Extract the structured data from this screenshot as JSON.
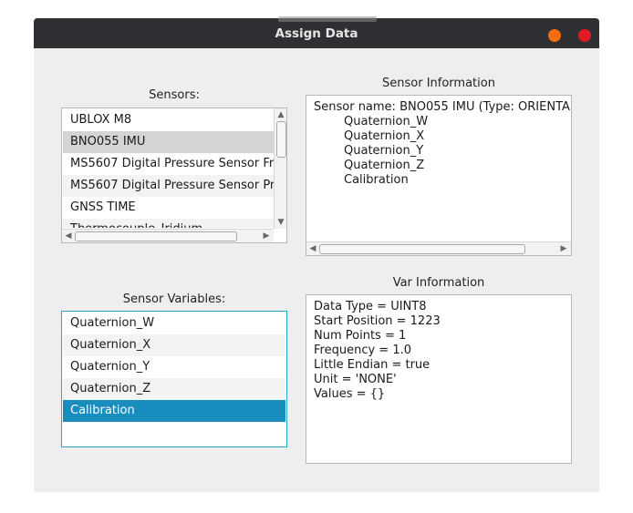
{
  "window": {
    "title": "Assign Data"
  },
  "sensors": {
    "label": "Sensors:",
    "items": [
      "UBLOX M8",
      "BNO055 IMU",
      "MS5607 Digital Pressure Sensor Fr",
      "MS5607 Digital Pressure Sensor Pr",
      "GNSS TIME",
      "Thermocouple_Iridium"
    ],
    "selected": "BNO055 IMU"
  },
  "sensor_info": {
    "label": "Sensor Information",
    "lines": [
      "Sensor name: BNO055 IMU (Type: ORIENTA",
      "Quaternion_W",
      "Quaternion_X",
      "Quaternion_Y",
      "Quaternion_Z",
      "Calibration"
    ]
  },
  "variables": {
    "label": "Sensor Variables:",
    "items": [
      "Quaternion_W",
      "Quaternion_X",
      "Quaternion_Y",
      "Quaternion_Z",
      "Calibration"
    ],
    "selected": "Calibration"
  },
  "var_info": {
    "label": "Var Information",
    "lines": [
      "Data Type = UINT8",
      "Start Position = 1223",
      "Num Points = 1",
      "Frequency = 1.0",
      "Little Endian = true",
      "Unit = 'NONE'",
      "Values = {}"
    ]
  },
  "colors": {
    "selection": "#1a8dbf",
    "selection_inactive": "#d4d4d4",
    "focus_border": "#2ea3d6"
  },
  "icons": {
    "scroll_up": "▲",
    "scroll_down": "▼",
    "scroll_left": "◀",
    "scroll_right": "▶"
  }
}
